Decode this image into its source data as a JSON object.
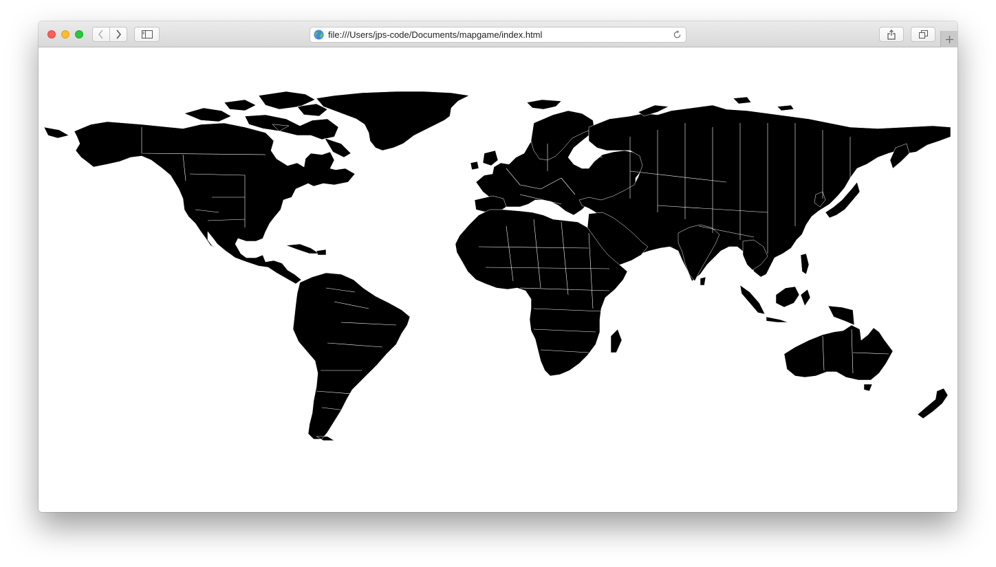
{
  "browser": {
    "url": "file:///Users/jps-code/Documents/mapgame/index.html",
    "icons": {
      "back": "chevron-left-icon",
      "forward": "chevron-right-icon",
      "sidebar": "sidebar-icon",
      "site": "globe-icon",
      "reload": "reload-icon",
      "share": "share-icon",
      "tabs": "tabs-overview-icon",
      "new_tab": "plus-icon"
    }
  },
  "map": {
    "land_color": "#000000",
    "ocean_color": "#ffffff",
    "border_color": "#ffffff"
  }
}
